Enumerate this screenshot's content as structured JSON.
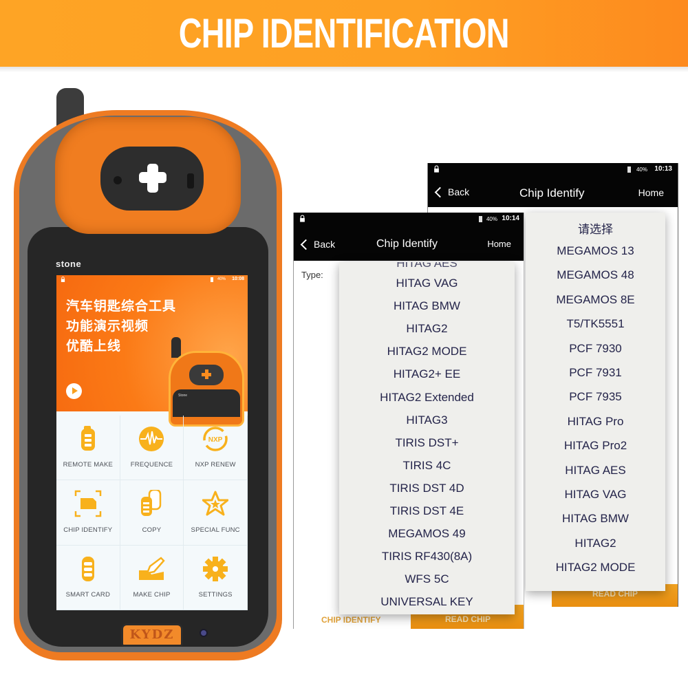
{
  "banner": {
    "title": "CHIP IDENTIFICATION",
    "color_start": "#fea425",
    "color_end": "#fd8a1e"
  },
  "device": {
    "brand": "stone",
    "logo": "KYDZ",
    "body_color": "#ee7b22",
    "screen": {
      "status": {
        "battery": "40%",
        "time": "10:08"
      },
      "hero_lines": [
        "汽车钥匙综合工具",
        "功能演示视频",
        "优酷上线"
      ],
      "mini_device_brand": "Stone",
      "tiles": [
        {
          "label": "REMOTE MAKE",
          "icon": "car-key-icon"
        },
        {
          "label": "FREQUENCE",
          "icon": "frequency-wave-icon"
        },
        {
          "label": "NXP RENEW",
          "icon": "nxp-renew-icon",
          "icon_text": "NXP"
        },
        {
          "label": "CHIP IDENTIFY",
          "icon": "chip-scan-icon"
        },
        {
          "label": "COPY",
          "icon": "copy-keys-icon"
        },
        {
          "label": "SPECIAL FUNC",
          "icon": "star-icon"
        },
        {
          "label": "SMART CARD",
          "icon": "smart-key-icon"
        },
        {
          "label": "MAKE CHIP",
          "icon": "pencil-chip-icon"
        },
        {
          "label": "SETTINGS",
          "icon": "gear-icon"
        }
      ],
      "accent": "#f8b11c"
    }
  },
  "screens": {
    "back": {
      "status": {
        "battery": "40%",
        "time": "10:13"
      },
      "nav": {
        "back": "Back",
        "title": "Chip Identify",
        "home": "Home"
      },
      "read_button": "READ CHIP",
      "popup_header": "请选择",
      "items": [
        "MEGAMOS 13",
        "MEGAMOS 48",
        "MEGAMOS 8E",
        "T5/TK5551",
        "PCF 7930",
        "PCF 7931",
        "PCF 7935",
        "HITAG Pro",
        "HITAG Pro2",
        "HITAG AES",
        "HITAG VAG",
        "HITAG BMW",
        "HITAG2",
        "HITAG2 MODE"
      ]
    },
    "front": {
      "status": {
        "battery": "40%",
        "time": "10:14"
      },
      "nav": {
        "back": "Back",
        "title": "Chip Identify",
        "home": "Home"
      },
      "type_label": "Type:",
      "bottom_label": "CHIP IDENTIFY",
      "read_button": "READ CHIP",
      "items": [
        "HITAG VAG",
        "HITAG BMW",
        "HITAG2",
        "HITAG2 MODE",
        "HITAG2+ EE",
        "HITAG2 Extended",
        "HITAG3",
        "TIRIS DST+",
        "TIRIS 4C",
        "TIRIS DST 4D",
        "TIRIS DST 4E",
        "MEGAMOS 49",
        "TIRIS RF430(8A)",
        "WFS 5C",
        "UNIVERSAL KEY"
      ]
    }
  }
}
